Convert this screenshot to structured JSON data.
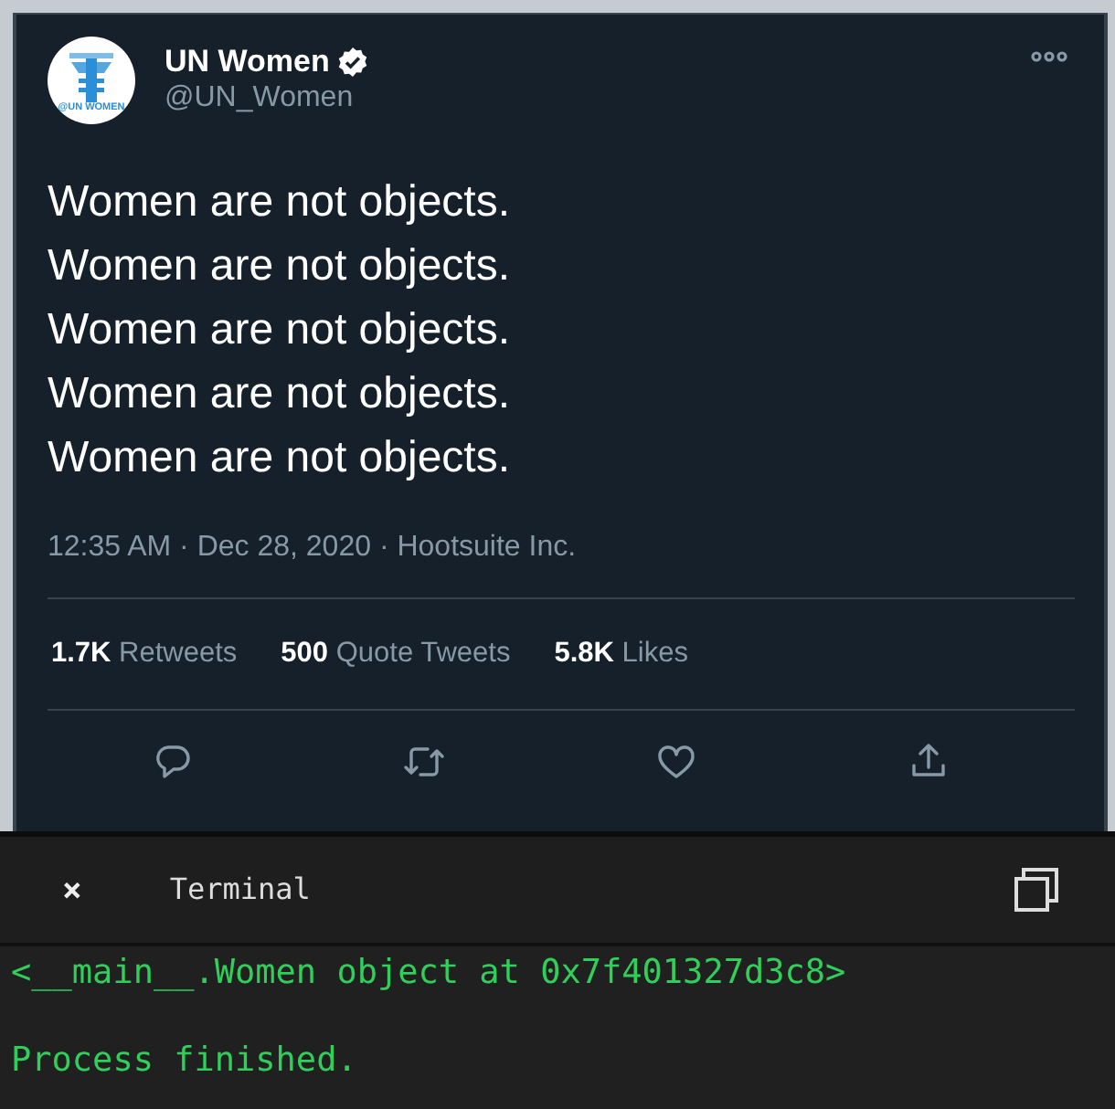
{
  "tweet": {
    "author": {
      "name": "UN Women",
      "handle": "@UN_Women",
      "verified": true,
      "logo_text": "@UN WOMEN"
    },
    "lines": [
      "Women are not objects.",
      "Women are not objects.",
      "Women are not objects.",
      "Women are not objects.",
      "Women are not objects."
    ],
    "meta": "12:35 AM · Dec 28, 2020 · Hootsuite Inc.",
    "stats": [
      {
        "count": "1.7K",
        "label": "Retweets"
      },
      {
        "count": "500",
        "label": "Quote Tweets"
      },
      {
        "count": "5.8K",
        "label": "Likes"
      }
    ],
    "actions": [
      {
        "kind": "reply"
      },
      {
        "kind": "retweet"
      },
      {
        "kind": "like"
      },
      {
        "kind": "share"
      }
    ]
  },
  "terminal": {
    "close": "×",
    "title": "Terminal",
    "output": [
      "<__main__.Women object at 0x7f401327d3c8>",
      "Process finished."
    ]
  }
}
